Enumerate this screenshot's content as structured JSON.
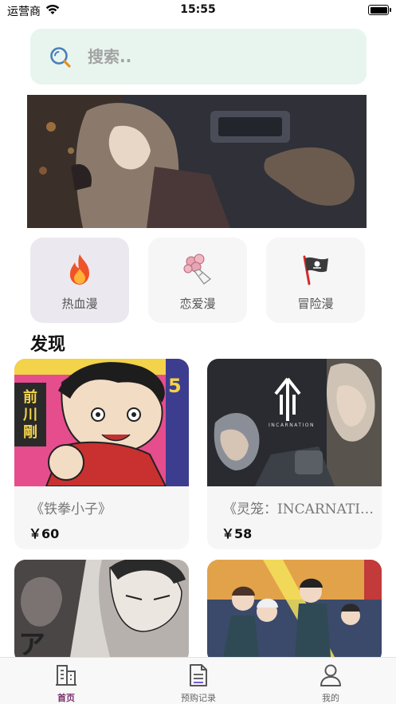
{
  "status_bar": {
    "carrier": "运营商",
    "time": "15:55"
  },
  "search": {
    "placeholder": "搜索.."
  },
  "categories": [
    {
      "label": "热血漫",
      "icon": "flame-icon"
    },
    {
      "label": "恋爱漫",
      "icon": "bouquet-icon"
    },
    {
      "label": "冒险漫",
      "icon": "pirate-flag-icon"
    }
  ],
  "section_title": "发现",
  "cards": [
    {
      "title": "《铁拳小子》",
      "price": "￥60",
      "cover_text": "前川 剛"
    },
    {
      "title": "《灵笼：INCARNATION》",
      "price": "￥58",
      "cover_text": "INCARNATION"
    },
    {
      "title": "",
      "price": "",
      "cover_text": ""
    },
    {
      "title": "",
      "price": "",
      "cover_text": ""
    }
  ],
  "tabs": [
    {
      "label": "首页",
      "icon": "building-icon",
      "active": true
    },
    {
      "label": "预购记录",
      "icon": "document-icon",
      "active": false
    },
    {
      "label": "我的",
      "icon": "user-icon",
      "active": false
    }
  ],
  "colors": {
    "accent": "#7a2f6e",
    "search_bg": "#e8f5ef",
    "card_bg": "#f6f6f6"
  }
}
